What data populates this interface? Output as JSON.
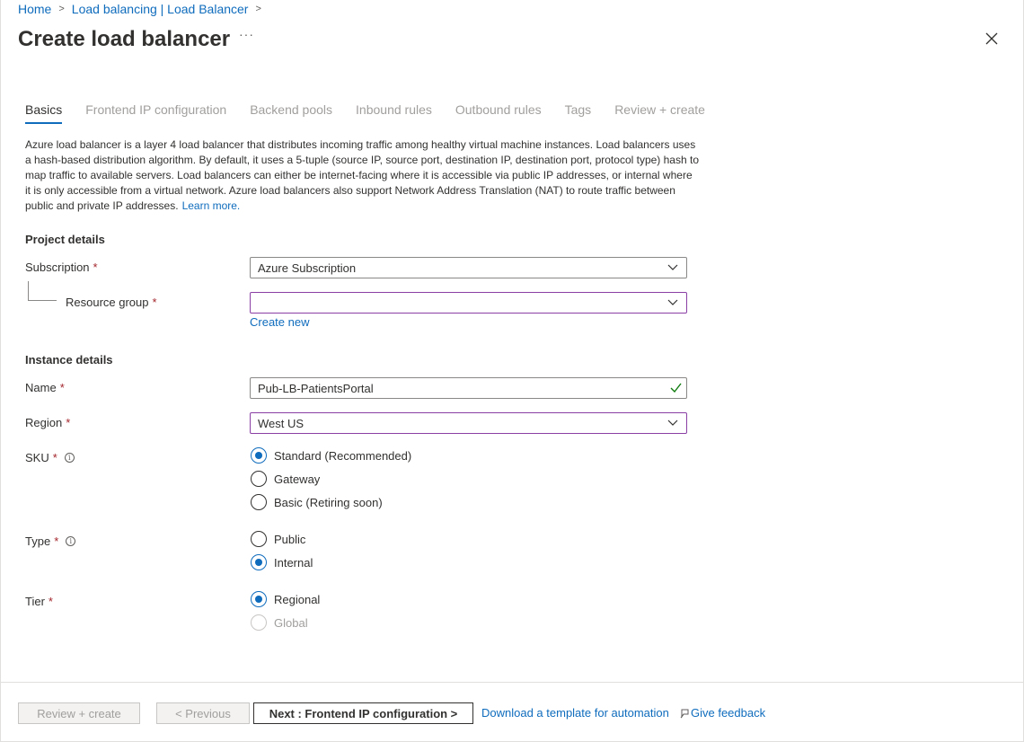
{
  "breadcrumb": [
    {
      "label": "Home"
    },
    {
      "label": "Load balancing | Load Balancer"
    }
  ],
  "page": {
    "title": "Create load balancer",
    "more_label": "···"
  },
  "tabs": [
    {
      "label": "Basics",
      "active": true
    },
    {
      "label": "Frontend IP configuration",
      "active": false
    },
    {
      "label": "Backend pools",
      "active": false
    },
    {
      "label": "Inbound rules",
      "active": false
    },
    {
      "label": "Outbound rules",
      "active": false
    },
    {
      "label": "Tags",
      "active": false
    },
    {
      "label": "Review + create",
      "active": false
    }
  ],
  "description": {
    "text": "Azure load balancer is a layer 4 load balancer that distributes incoming traffic among healthy virtual machine instances. Load balancers uses a hash-based distribution algorithm. By default, it uses a 5-tuple (source IP, source port, destination IP, destination port, protocol type) hash to map traffic to available servers. Load balancers can either be internet-facing where it is accessible via public IP addresses, or internal where it is only accessible from a virtual network. Azure load balancers also support Network Address Translation (NAT) to route traffic between public and private IP addresses.",
    "learn_more": "Learn more."
  },
  "project_details": {
    "heading": "Project details",
    "subscription_label": "Subscription",
    "subscription_value": "Azure Subscription",
    "resource_group_label": "Resource group",
    "resource_group_value": "",
    "create_new": "Create new"
  },
  "instance_details": {
    "heading": "Instance details",
    "name_label": "Name",
    "name_value": "Pub-LB-PatientsPortal",
    "region_label": "Region",
    "region_value": "West US",
    "sku_label": "SKU",
    "sku_options": [
      {
        "label": "Standard (Recommended)",
        "selected": true
      },
      {
        "label": "Gateway",
        "selected": false
      },
      {
        "label": "Basic (Retiring soon)",
        "selected": false
      }
    ],
    "type_label": "Type",
    "type_options": [
      {
        "label": "Public",
        "selected": false
      },
      {
        "label": "Internal",
        "selected": true
      }
    ],
    "tier_label": "Tier",
    "tier_options": [
      {
        "label": "Regional",
        "selected": true
      },
      {
        "label": "Global",
        "selected": false,
        "disabled": true
      }
    ]
  },
  "required_marker": "*",
  "footer": {
    "review_create": "Review + create",
    "previous": "< Previous",
    "next": "Next : Frontend IP configuration >",
    "download_template": "Download a template for automation",
    "give_feedback": "Give feedback"
  },
  "colors": {
    "accent": "#0f6cbd",
    "required": "#a4262c",
    "focus_border": "#8a3fa4",
    "valid_check": "#107c10"
  }
}
